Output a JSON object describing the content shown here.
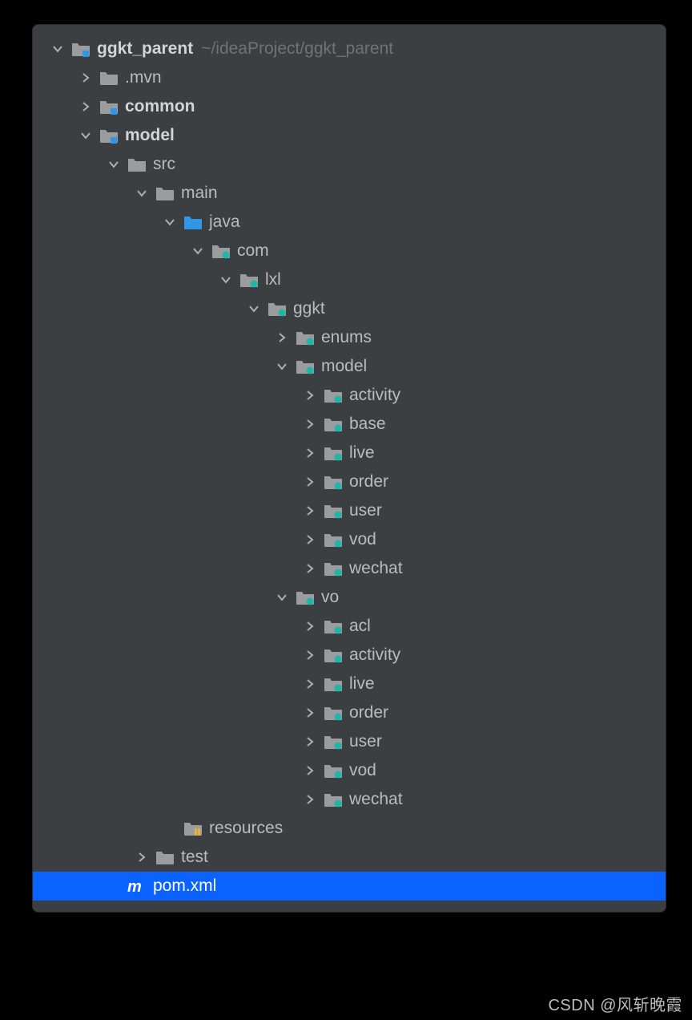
{
  "watermark": "CSDN @风斩晚霞",
  "tree": [
    {
      "depth": 0,
      "arrow": "down",
      "icon": "module",
      "label": "ggkt_parent",
      "bold": true,
      "hint": "~/ideaProject/ggkt_parent"
    },
    {
      "depth": 1,
      "arrow": "right",
      "icon": "folder",
      "label": ".mvn"
    },
    {
      "depth": 1,
      "arrow": "right",
      "icon": "module",
      "label": "common",
      "bold": true
    },
    {
      "depth": 1,
      "arrow": "down",
      "icon": "module",
      "label": "model",
      "bold": true
    },
    {
      "depth": 2,
      "arrow": "down",
      "icon": "folder",
      "label": "src"
    },
    {
      "depth": 3,
      "arrow": "down",
      "icon": "folder",
      "label": "main"
    },
    {
      "depth": 4,
      "arrow": "down",
      "icon": "source-folder",
      "label": "java"
    },
    {
      "depth": 5,
      "arrow": "down",
      "icon": "package",
      "label": "com"
    },
    {
      "depth": 6,
      "arrow": "down",
      "icon": "package",
      "label": "lxl"
    },
    {
      "depth": 7,
      "arrow": "down",
      "icon": "package",
      "label": "ggkt"
    },
    {
      "depth": 8,
      "arrow": "right",
      "icon": "package",
      "label": "enums"
    },
    {
      "depth": 8,
      "arrow": "down",
      "icon": "package",
      "label": "model"
    },
    {
      "depth": 9,
      "arrow": "right",
      "icon": "package",
      "label": "activity"
    },
    {
      "depth": 9,
      "arrow": "right",
      "icon": "package",
      "label": "base"
    },
    {
      "depth": 9,
      "arrow": "right",
      "icon": "package",
      "label": "live"
    },
    {
      "depth": 9,
      "arrow": "right",
      "icon": "package",
      "label": "order"
    },
    {
      "depth": 9,
      "arrow": "right",
      "icon": "package",
      "label": "user"
    },
    {
      "depth": 9,
      "arrow": "right",
      "icon": "package",
      "label": "vod"
    },
    {
      "depth": 9,
      "arrow": "right",
      "icon": "package",
      "label": "wechat"
    },
    {
      "depth": 8,
      "arrow": "down",
      "icon": "package",
      "label": "vo"
    },
    {
      "depth": 9,
      "arrow": "right",
      "icon": "package",
      "label": "acl"
    },
    {
      "depth": 9,
      "arrow": "right",
      "icon": "package",
      "label": "activity"
    },
    {
      "depth": 9,
      "arrow": "right",
      "icon": "package",
      "label": "live"
    },
    {
      "depth": 9,
      "arrow": "right",
      "icon": "package",
      "label": "order"
    },
    {
      "depth": 9,
      "arrow": "right",
      "icon": "package",
      "label": "user"
    },
    {
      "depth": 9,
      "arrow": "right",
      "icon": "package",
      "label": "vod"
    },
    {
      "depth": 9,
      "arrow": "right",
      "icon": "package",
      "label": "wechat"
    },
    {
      "depth": 4,
      "arrow": "none",
      "icon": "resources-folder",
      "label": "resources"
    },
    {
      "depth": 3,
      "arrow": "right",
      "icon": "folder",
      "label": "test"
    },
    {
      "depth": 2,
      "arrow": "none",
      "icon": "maven",
      "label": "pom.xml",
      "selected": true
    }
  ],
  "indentUnit": 35,
  "baseIndent": 20
}
